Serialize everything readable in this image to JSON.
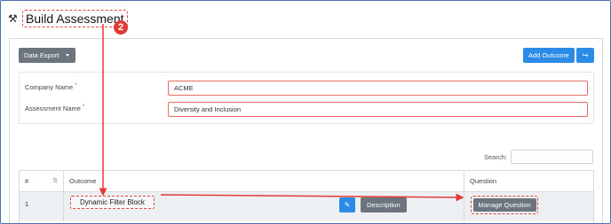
{
  "header": {
    "icon": "tools-icon",
    "title": "Build Assessment"
  },
  "annotation": {
    "step_number": "2",
    "color": "#e23b33"
  },
  "toolbar": {
    "data_export_label": "Data Export",
    "add_outcome_label": "Add Outcome",
    "share_icon": "share-arrow-icon"
  },
  "form": {
    "company_label": "Company Name",
    "company_value": "ACME",
    "assessment_label": "Assessment Name",
    "assessment_value": "Diversity and Inclusion",
    "required_mark": "*"
  },
  "search": {
    "label": "Search:",
    "value": ""
  },
  "table": {
    "columns": [
      "#",
      "Outcome",
      "Question"
    ],
    "rows": [
      {
        "index": "1",
        "outcome": "Dynamic Filter Block",
        "description_label": "Description",
        "manage_question_label": "Manage Question"
      }
    ]
  },
  "colors": {
    "primary": "#2b8be6",
    "secondary": "#6c757d",
    "highlight": "#e0463d"
  }
}
